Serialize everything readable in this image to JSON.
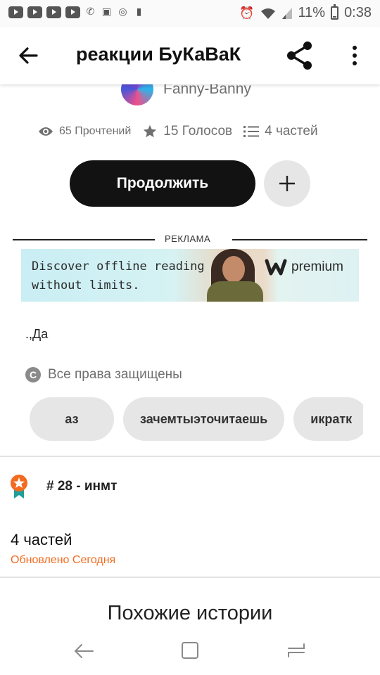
{
  "status_bar": {
    "battery": "11%",
    "time": "0:38"
  },
  "header": {
    "title": "реакции БуКаВаК"
  },
  "author": {
    "name": "Fanny-Banny"
  },
  "stats": {
    "reads": "65 Прочтений",
    "votes": "15 Голосов",
    "parts": "4 частей"
  },
  "actions": {
    "continue_label": "Продолжить"
  },
  "ad": {
    "label": "РЕКЛАМА",
    "line1": "Discover offline reading",
    "line2": "without limits.",
    "brand": "premium"
  },
  "story": {
    "description": ".,Да",
    "copyright": "Все права защищены",
    "tags": [
      "аз",
      "зачемтыэточитаешь",
      "икратк"
    ],
    "ranking": "# 28 - инмт",
    "parts_title": "4 частей",
    "updated": "Обновлено Сегодня"
  },
  "similar": {
    "title": "Похожие истории"
  },
  "colors": {
    "accent": "#f26b21",
    "button_dark": "#121212",
    "chip_bg": "#e6e6e6"
  }
}
